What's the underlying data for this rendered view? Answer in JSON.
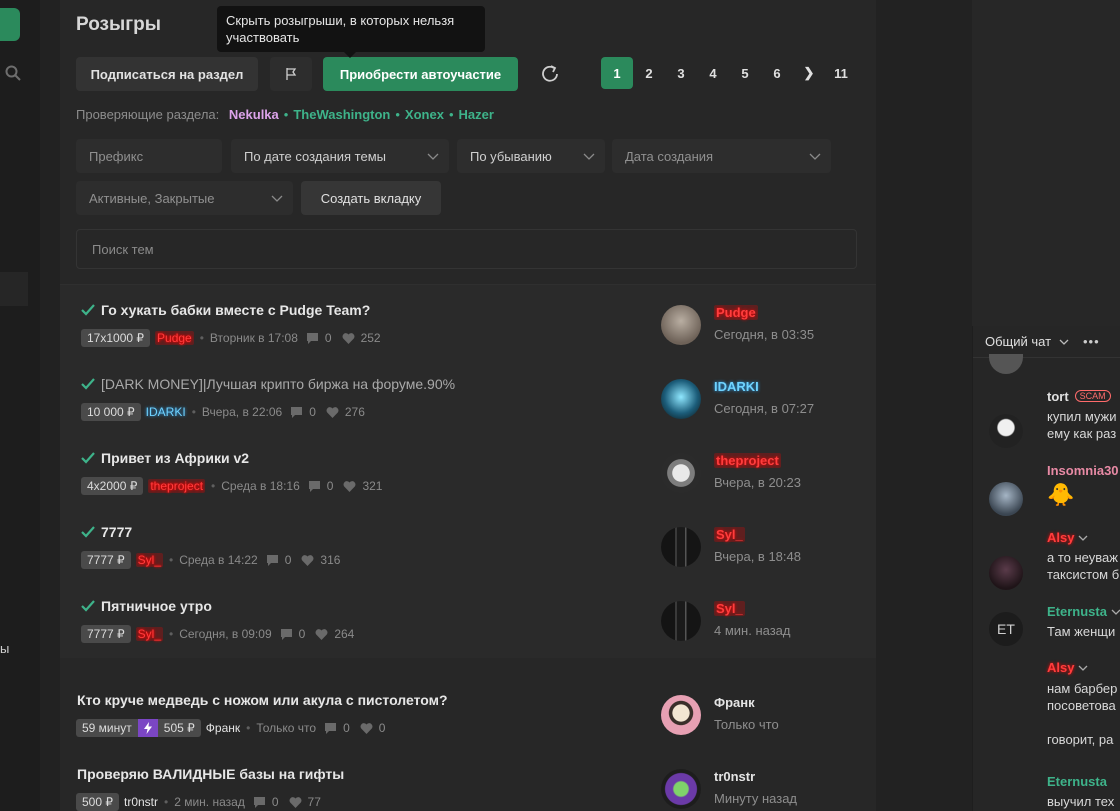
{
  "page": {
    "title": "Розыгры",
    "tooltip": "Скрыть розыгрыши, в которых нельзя участвовать",
    "left_fragment": "ы"
  },
  "toolbar": {
    "subscribe_label": "Подписаться на раздел",
    "flag_icon": "flag-icon",
    "autoparticipate_label": "Приобрести автоучастие",
    "refresh_icon": "refresh-icon"
  },
  "pagination": {
    "pages": [
      "1",
      "2",
      "3",
      "4",
      "5",
      "6"
    ],
    "next": "❯",
    "last": "11",
    "current": "1"
  },
  "moderators": {
    "label": "Проверяющие раздела:",
    "names": [
      "Nekulka",
      "TheWashington",
      "Xonex",
      "Hazer"
    ],
    "sep": "•"
  },
  "filters": {
    "prefix_placeholder": "Префикс",
    "sort_by": "По дате создания темы",
    "order": "По убыванию",
    "date_placeholder": "Дата создания",
    "state": "Активные, Закрытые",
    "create_tab_label": "Создать вкладку",
    "search_placeholder": "Поиск тем"
  },
  "topics": [
    {
      "title": "Го хукать бабки вместе с Pudge Team?",
      "read": false,
      "tag": "17x1000 ₽",
      "author": "Pudge",
      "when": "Вторник в 17:08",
      "replies": "0",
      "likes": "252",
      "last_user": "Pudge",
      "last_time": "Сегодня, в 03:35"
    },
    {
      "title": "[DARK MONEY]|Лучшая крипто биржа на форуме.90%",
      "read": true,
      "tag": "10 000 ₽",
      "author": "IDARKI",
      "when": "Вчера, в 22:06",
      "replies": "0",
      "likes": "276",
      "last_user": "IDARKI",
      "last_time": "Сегодня, в 07:27"
    },
    {
      "title": "Привет из Африки v2",
      "read": false,
      "tag": "4x2000 ₽",
      "author": "theproject",
      "when": "Среда в 18:16",
      "replies": "0",
      "likes": "321",
      "last_user": "theproject",
      "last_time": "Вчера, в 20:23"
    },
    {
      "title": "7777",
      "read": false,
      "tag": "7777 ₽",
      "author": "Syl_",
      "when": "Среда в 14:22",
      "replies": "0",
      "likes": "316",
      "last_user": "Syl_",
      "last_time": "Вчера, в 18:48"
    },
    {
      "title": "Пятничное утро",
      "read": false,
      "tag": "7777 ₽",
      "author": "Syl_",
      "when": "Сегодня, в 09:09",
      "replies": "0",
      "likes": "264",
      "last_user": "Syl_",
      "last_time": "4 мин. назад"
    },
    {
      "title": "Кто круче медведь с ножом или акула с пистолетом?",
      "read": false,
      "tag": "59 минут",
      "tag2": "505 ₽",
      "author": "Франк",
      "when": "Только что",
      "replies": "0",
      "likes": "0",
      "last_user": "Франк",
      "last_time": "Только что"
    },
    {
      "title": "Проверяю ВАЛИДНЫЕ базы на гифты",
      "read": false,
      "tag": "500 ₽",
      "author": "tr0nstr",
      "when": "2 мин. назад",
      "replies": "0",
      "likes": "77",
      "last_user": "tr0nstr",
      "last_time": "Минуту назад"
    }
  ],
  "chat": {
    "title": "Общий чат",
    "messages": [
      {
        "name": "tort",
        "badge": "SCAM",
        "text": [
          "купил мужи",
          "ему как раз"
        ]
      },
      {
        "name": "Insomnia30",
        "text": [
          "🐥"
        ]
      },
      {
        "name": "Alsy",
        "text": [
          "а то неуваж",
          "таксистом б"
        ]
      },
      {
        "name": "Eternusta",
        "avatar_text": "ET",
        "text": [
          "Там женщи"
        ]
      },
      {
        "name": "Alsy",
        "text": [
          "нам барбер",
          "посоветова",
          "",
          "говорит, ра"
        ]
      },
      {
        "name": "Eternusta",
        "text": [
          "выучил тех"
        ]
      }
    ]
  },
  "colors": {
    "accent": "#2b8a5c",
    "mod_green": "#3eb38a",
    "mod_pink": "#dca3ea",
    "highlight_red": "#ff3d3d",
    "highlight_cyan": "#6fd3ff",
    "bolt_purple": "#7b46c4"
  }
}
